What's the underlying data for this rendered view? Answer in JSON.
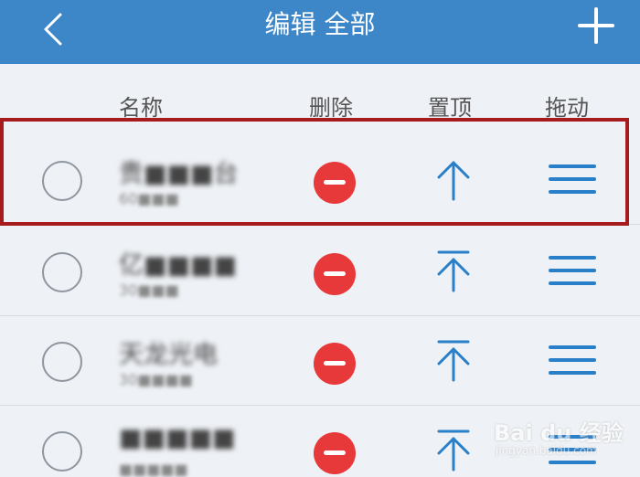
{
  "header": {
    "title": "编辑 全部",
    "back_icon": "chevron-left-icon",
    "add_icon": "plus-icon",
    "background": "#3d86c8"
  },
  "columns": {
    "name": "名称",
    "delete": "删除",
    "pin_top": "置顶",
    "drag": "拖动"
  },
  "rows": [
    {
      "name": "贵■■■台",
      "code": "60■■■"
    },
    {
      "name": "亿■■■■",
      "code": "30■■■"
    },
    {
      "name": "天龙光电",
      "code": "30■■■■"
    },
    {
      "name": "■■■■■",
      "code": "■■■■■"
    }
  ],
  "accent": {
    "delete_red": "#e8393a",
    "action_blue": "#2a7fc9",
    "highlight_red": "#a61b1b"
  },
  "watermark": {
    "text": "Bai du 经验",
    "sub": "jingyan.baidu.com"
  }
}
